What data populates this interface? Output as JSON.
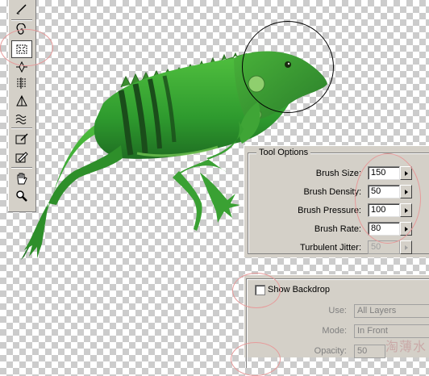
{
  "tool_options": {
    "title": "Tool Options",
    "fields": [
      {
        "label": "Brush Size:",
        "value": "150",
        "enabled": true
      },
      {
        "label": "Brush Density:",
        "value": "50",
        "enabled": true
      },
      {
        "label": "Brush Pressure:",
        "value": "100",
        "enabled": true
      },
      {
        "label": "Brush Rate:",
        "value": "80",
        "enabled": true
      },
      {
        "label": "Turbulent Jitter:",
        "value": "50",
        "enabled": false
      }
    ]
  },
  "backdrop": {
    "show_label": "Show Backdrop",
    "checked": false,
    "use_label": "Use:",
    "use_value": "All Layers",
    "mode_label": "Mode:",
    "mode_value": "In Front",
    "opacity_label": "Opacity:",
    "opacity_value": "50"
  },
  "toolbar": {
    "tools": [
      "forward-warp-tool-icon",
      "twirl-tool-icon",
      "pucker-tool-icon",
      "bloat-tool-icon",
      "push-left-tool-icon",
      "mirror-tool-icon",
      "turbulence-tool-icon",
      "reconstruct-tool-icon",
      "freeze-mask-tool-icon",
      "thaw-mask-tool-icon",
      "hand-tool-icon",
      "zoom-tool-icon"
    ],
    "selected": "pucker-tool-icon"
  },
  "colors": {
    "panel_bg": "#d4d0c8",
    "annotation": "#e79a9a",
    "iguana_green": "#2e9a2e"
  },
  "watermark": "淘薄水"
}
